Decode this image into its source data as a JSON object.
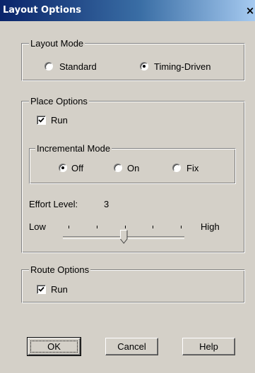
{
  "window": {
    "title": "Layout Options",
    "close_label": "×"
  },
  "layout_mode": {
    "legend": "Layout Mode",
    "options": [
      {
        "label": "Standard",
        "selected": false
      },
      {
        "label": "Timing-Driven",
        "selected": true
      }
    ]
  },
  "place_options": {
    "legend": "Place Options",
    "run": {
      "label": "Run",
      "checked": true
    },
    "incremental_mode": {
      "legend": "Incremental Mode",
      "options": [
        {
          "label": "Off",
          "selected": true
        },
        {
          "label": "On",
          "selected": false
        },
        {
          "label": "Fix",
          "selected": false
        }
      ]
    },
    "effort": {
      "label": "Effort Level:",
      "value": "3",
      "low_label": "Low",
      "high_label": "High",
      "level_fraction": 0.5
    }
  },
  "route_options": {
    "legend": "Route Options",
    "run": {
      "label": "Run",
      "checked": true
    }
  },
  "buttons": {
    "ok": "OK",
    "cancel": "Cancel",
    "help": "Help"
  }
}
